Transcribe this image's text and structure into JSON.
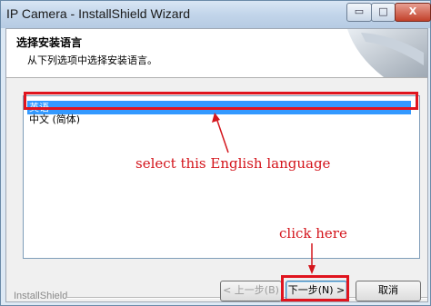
{
  "window": {
    "title": "IP Camera - InstallShield Wizard",
    "controls": {
      "minimize": "▭",
      "maximize": "□",
      "close": "X"
    }
  },
  "header": {
    "title": "选择安装语言",
    "subtitle": "从下列选项中选择安装语言。"
  },
  "languages": [
    {
      "label": "英语",
      "selected": true
    },
    {
      "label": "中文 (简体)",
      "selected": false
    }
  ],
  "annotations": {
    "select": "select this English language",
    "click": "click here",
    "color": "#e0141e"
  },
  "footer": {
    "brand": "InstallShield",
    "back_label": "< 上一步(B)",
    "next_label": "下一步(N) >",
    "cancel_label": "取消"
  },
  "colors": {
    "selection": "#3399ff",
    "title_bar": "#c2d5ea"
  }
}
